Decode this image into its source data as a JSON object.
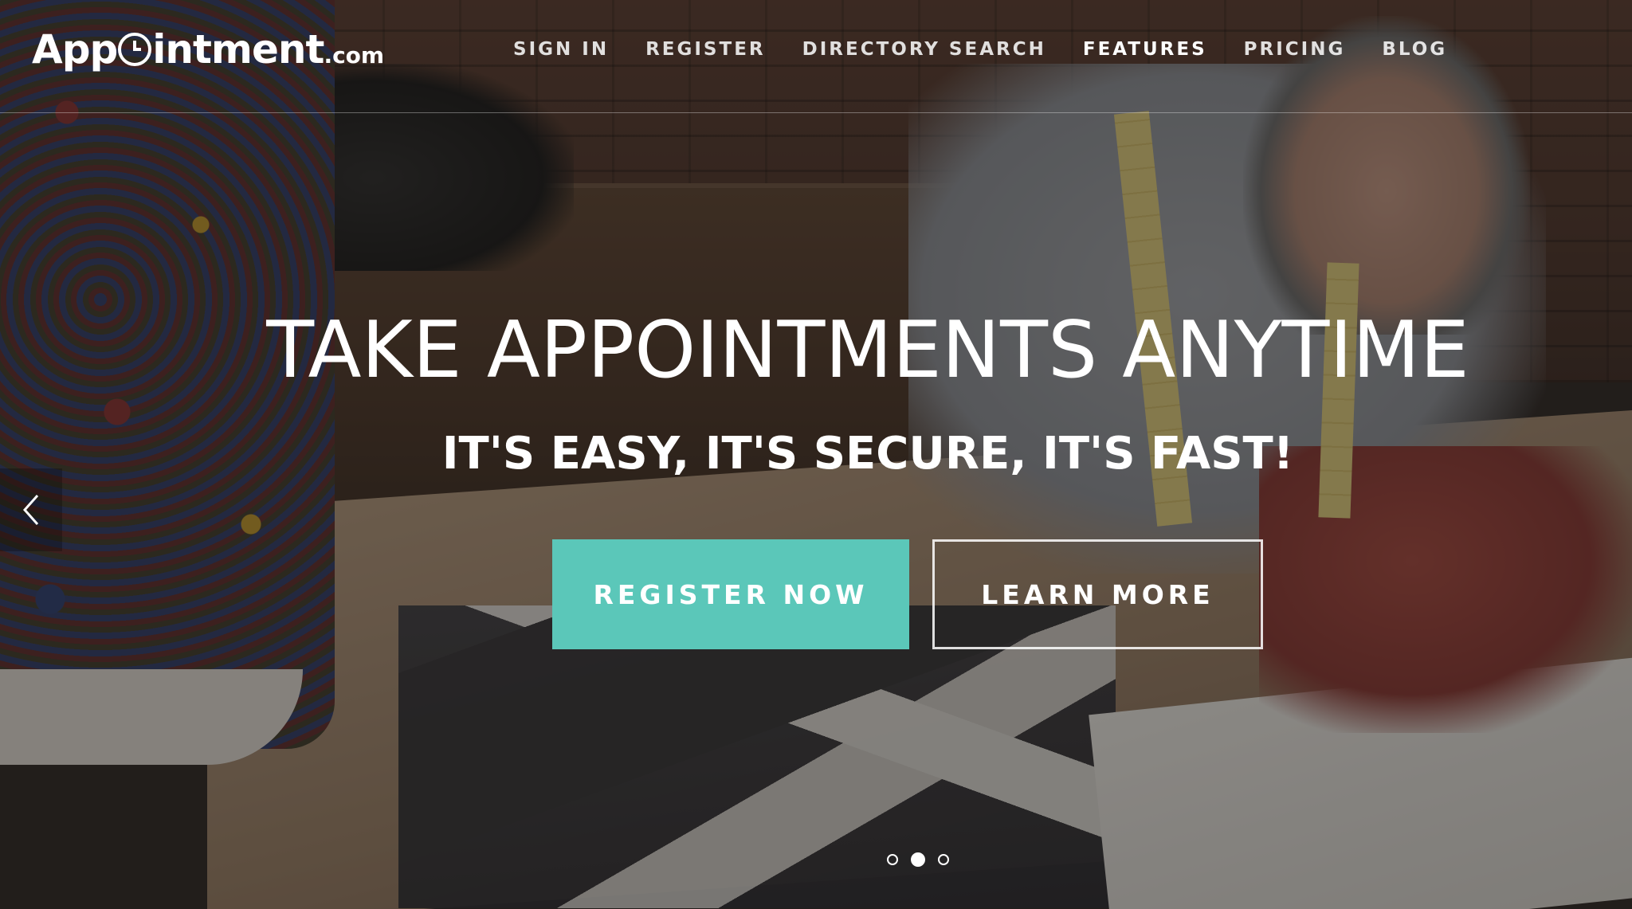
{
  "brand": {
    "name_part1": "App",
    "name_part2": "intment",
    "tld": ".com"
  },
  "nav": {
    "items": [
      {
        "label": "SIGN IN",
        "active": false
      },
      {
        "label": "REGISTER",
        "active": false
      },
      {
        "label": "DIRECTORY SEARCH",
        "active": false
      },
      {
        "label": "FEATURES",
        "active": true
      },
      {
        "label": "PRICING",
        "active": false
      },
      {
        "label": "BLOG",
        "active": false
      }
    ]
  },
  "hero": {
    "headline": "TAKE APPOINTMENTS ANYTIME",
    "subheadline": "IT'S EASY, IT'S SECURE, IT'S FAST!",
    "register_button": "REGISTER NOW",
    "learn_button": "LEARN MORE"
  },
  "carousel": {
    "prev_icon": "chevron-left-icon",
    "slide_count": 3,
    "active_slide": 2
  },
  "colors": {
    "accent": "#5bc7b9",
    "text": "#ffffff"
  }
}
